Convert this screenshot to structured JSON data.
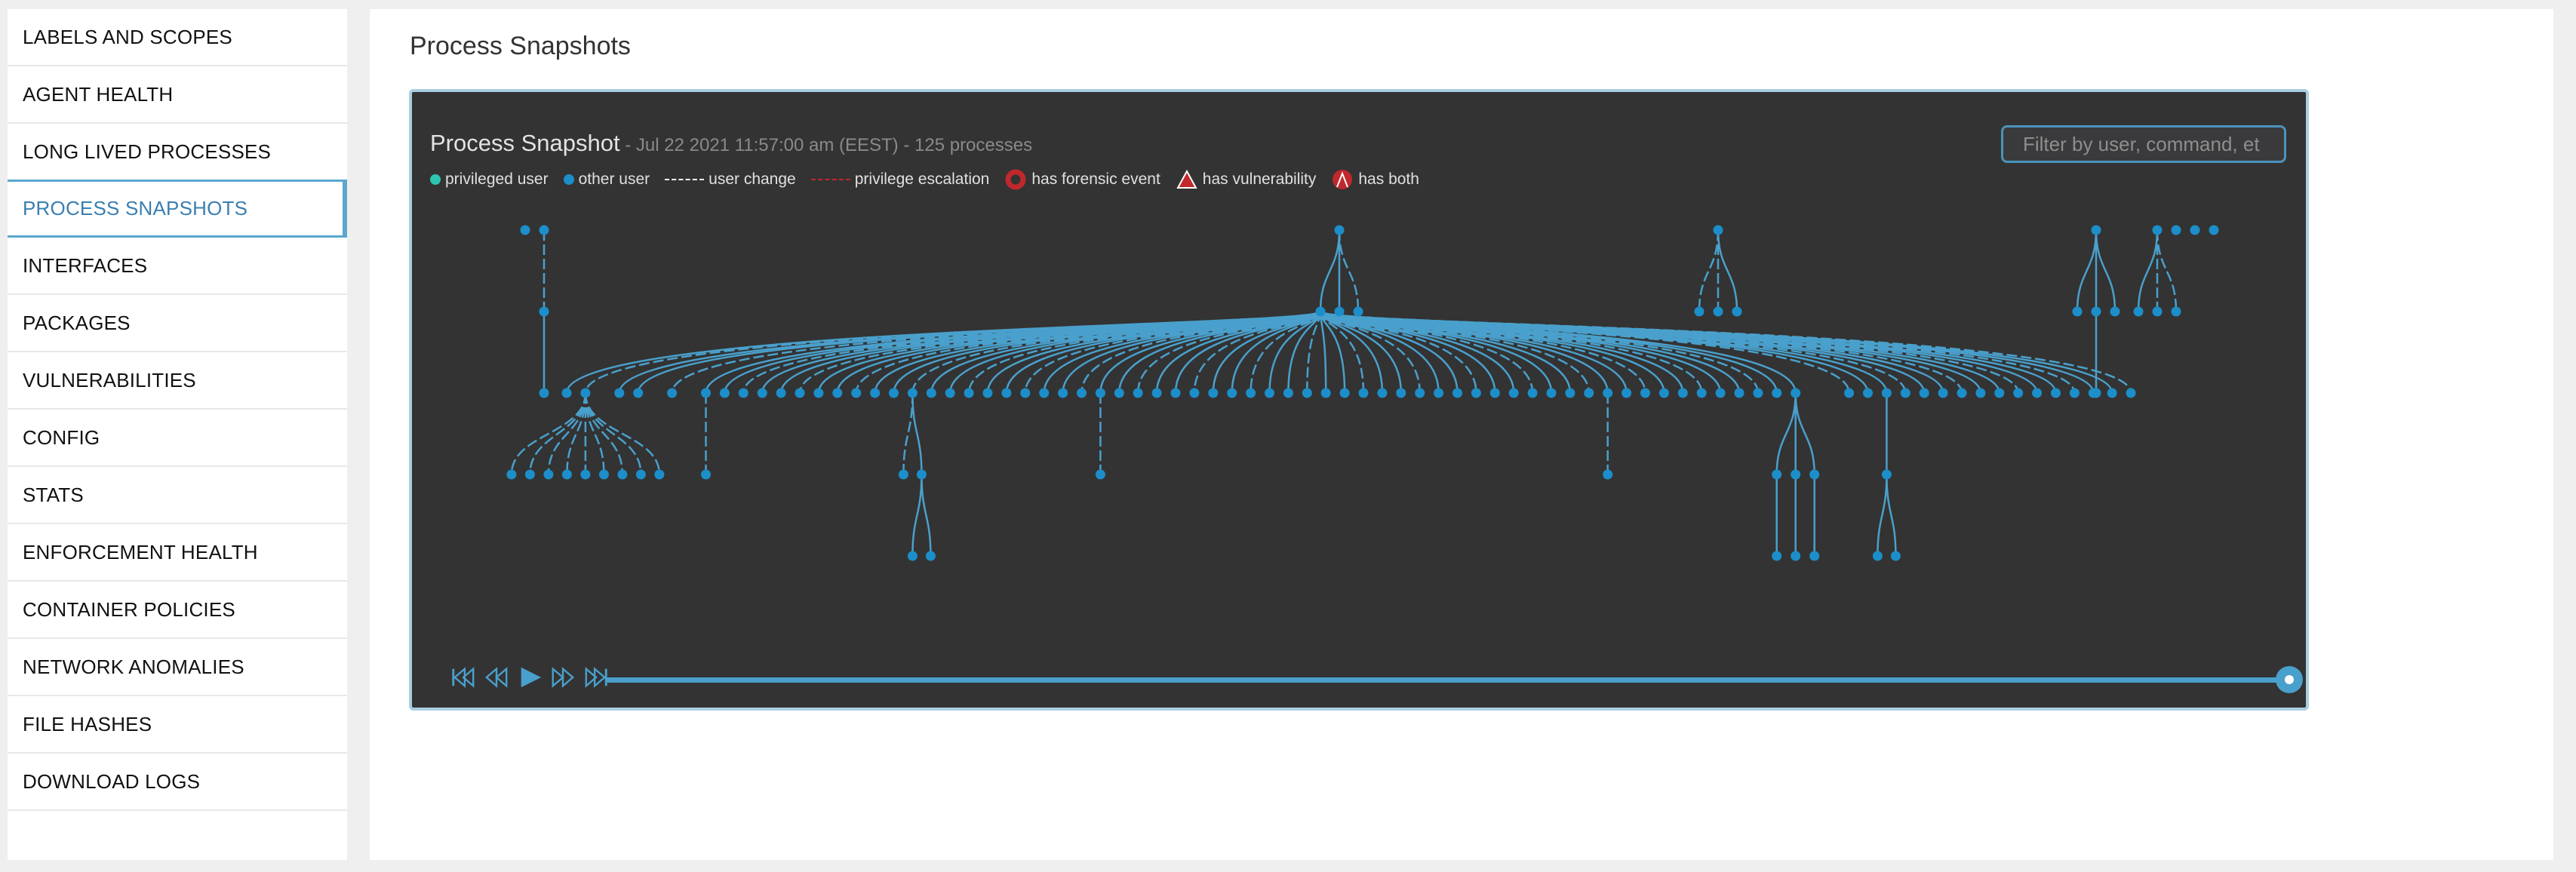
{
  "sidebar": {
    "items": [
      {
        "label": "LABELS AND SCOPES",
        "active": false
      },
      {
        "label": "AGENT HEALTH",
        "active": false
      },
      {
        "label": "LONG LIVED PROCESSES",
        "active": false
      },
      {
        "label": "PROCESS SNAPSHOTS",
        "active": true
      },
      {
        "label": "INTERFACES",
        "active": false
      },
      {
        "label": "PACKAGES",
        "active": false
      },
      {
        "label": "VULNERABILITIES",
        "active": false
      },
      {
        "label": "CONFIG",
        "active": false
      },
      {
        "label": "STATS",
        "active": false
      },
      {
        "label": "ENFORCEMENT HEALTH",
        "active": false
      },
      {
        "label": "CONTAINER POLICIES",
        "active": false
      },
      {
        "label": "NETWORK ANOMALIES",
        "active": false
      },
      {
        "label": "FILE HASHES",
        "active": false
      },
      {
        "label": "DOWNLOAD LOGS",
        "active": false
      }
    ]
  },
  "page": {
    "title": "Process Snapshots"
  },
  "snapshot": {
    "title": "Process Snapshot",
    "subtitle": " - Jul 22 2021 11:57:00 am (EEST) - 125 processes",
    "timestamp": "Jul 22 2021 11:57:00 am (EEST)",
    "process_count": 125,
    "filter_placeholder": "Filter by user, command, et",
    "filter_value": "",
    "legend": [
      {
        "type": "dot",
        "label": "privileged user",
        "color": "#2fc4b2"
      },
      {
        "type": "dot",
        "label": "other user",
        "color": "#1c8ec9"
      },
      {
        "type": "dashed",
        "label": "user change",
        "color": "#ffffff"
      },
      {
        "type": "dashed",
        "label": "privilege escalation",
        "color": "#c0282d"
      },
      {
        "type": "ring",
        "label": "has forensic event",
        "color": "#c0282d"
      },
      {
        "type": "triangle",
        "label": "has vulnerability",
        "color": "#c0282d"
      },
      {
        "type": "both",
        "label": "has both",
        "color": "#c0282d"
      }
    ],
    "colors": {
      "node": "#1c8ec9",
      "edge": "#4aa0cc",
      "panel_bg": "#333333",
      "accent": "#4aa0cc"
    },
    "tree": {
      "roots": [
        {
          "id": "r1",
          "children": []
        },
        {
          "id": "r2",
          "children": [
            {
              "id": "r2a",
              "edge": "dashed",
              "children": [
                {
                  "id": "r2a1",
                  "edge": "solid",
                  "children": []
                }
              ]
            }
          ]
        },
        {
          "id": "r3",
          "children": [
            {
              "id": "r3a",
              "edge": "solid",
              "hub": true,
              "children": "HUB"
            },
            {
              "id": "r3b",
              "edge": "solid",
              "children": []
            },
            {
              "id": "r3c",
              "edge": "dashed",
              "children": []
            }
          ]
        },
        {
          "id": "r4",
          "children": [
            {
              "id": "r4a",
              "edge": "dashed",
              "children": []
            },
            {
              "id": "r4b",
              "edge": "dashed",
              "children": []
            },
            {
              "id": "r4c",
              "edge": "solid",
              "children": []
            }
          ]
        },
        {
          "id": "r5",
          "children": [
            {
              "id": "r5a",
              "edge": "solid",
              "children": []
            },
            {
              "id": "r5b",
              "edge": "solid",
              "children": [
                {
                  "id": "r5b1",
                  "edge": "solid",
                  "children": []
                }
              ]
            },
            {
              "id": "r5c",
              "edge": "solid",
              "children": []
            }
          ]
        },
        {
          "id": "r6",
          "children": [
            {
              "id": "r6a",
              "edge": "solid",
              "children": []
            },
            {
              "id": "r6b",
              "edge": "dashed",
              "children": []
            },
            {
              "id": "r6c",
              "edge": "dashed",
              "children": []
            }
          ]
        },
        {
          "id": "r7",
          "children": []
        },
        {
          "id": "r8",
          "children": []
        },
        {
          "id": "r9",
          "children": []
        }
      ],
      "hub_children_count": 80,
      "hub_subtrees": [
        {
          "index": 1,
          "children": [
            {
              "edge": "dashed"
            },
            {
              "edge": "dashed"
            },
            {
              "edge": "dashed"
            },
            {
              "edge": "dashed"
            },
            {
              "edge": "dashed"
            },
            {
              "edge": "dashed"
            },
            {
              "edge": "dashed"
            },
            {
              "edge": "dashed"
            },
            {
              "edge": "dashed"
            }
          ]
        },
        {
          "index": 5,
          "children": [
            {
              "edge": "dashed"
            }
          ]
        },
        {
          "index": 16,
          "children": [
            {
              "edge": "dashed"
            },
            {
              "edge": "solid",
              "children": [
                {
                  "edge": "solid"
                },
                {
                  "edge": "solid"
                }
              ]
            }
          ]
        },
        {
          "index": 26,
          "children": [
            {
              "edge": "dashed"
            }
          ]
        },
        {
          "index": 53,
          "children": [
            {
              "edge": "dashed"
            }
          ]
        },
        {
          "index": 63,
          "children": [
            {
              "edge": "solid",
              "children": [
                {
                  "edge": "solid"
                }
              ]
            },
            {
              "edge": "solid",
              "children": [
                {
                  "edge": "solid"
                }
              ]
            },
            {
              "edge": "solid",
              "children": [
                {
                  "edge": "solid"
                }
              ]
            }
          ]
        },
        {
          "index": 66,
          "children": [
            {
              "edge": "solid",
              "children": [
                {
                  "edge": "solid"
                },
                {
                  "edge": "solid"
                }
              ]
            }
          ]
        }
      ]
    },
    "playback": {
      "buttons": [
        {
          "name": "skip-to-start",
          "label": "First"
        },
        {
          "name": "step-back",
          "label": "Previous"
        },
        {
          "name": "play",
          "label": "Play"
        },
        {
          "name": "step-forward",
          "label": "Next"
        },
        {
          "name": "skip-to-end",
          "label": "Last"
        }
      ],
      "position": 1.0
    }
  }
}
